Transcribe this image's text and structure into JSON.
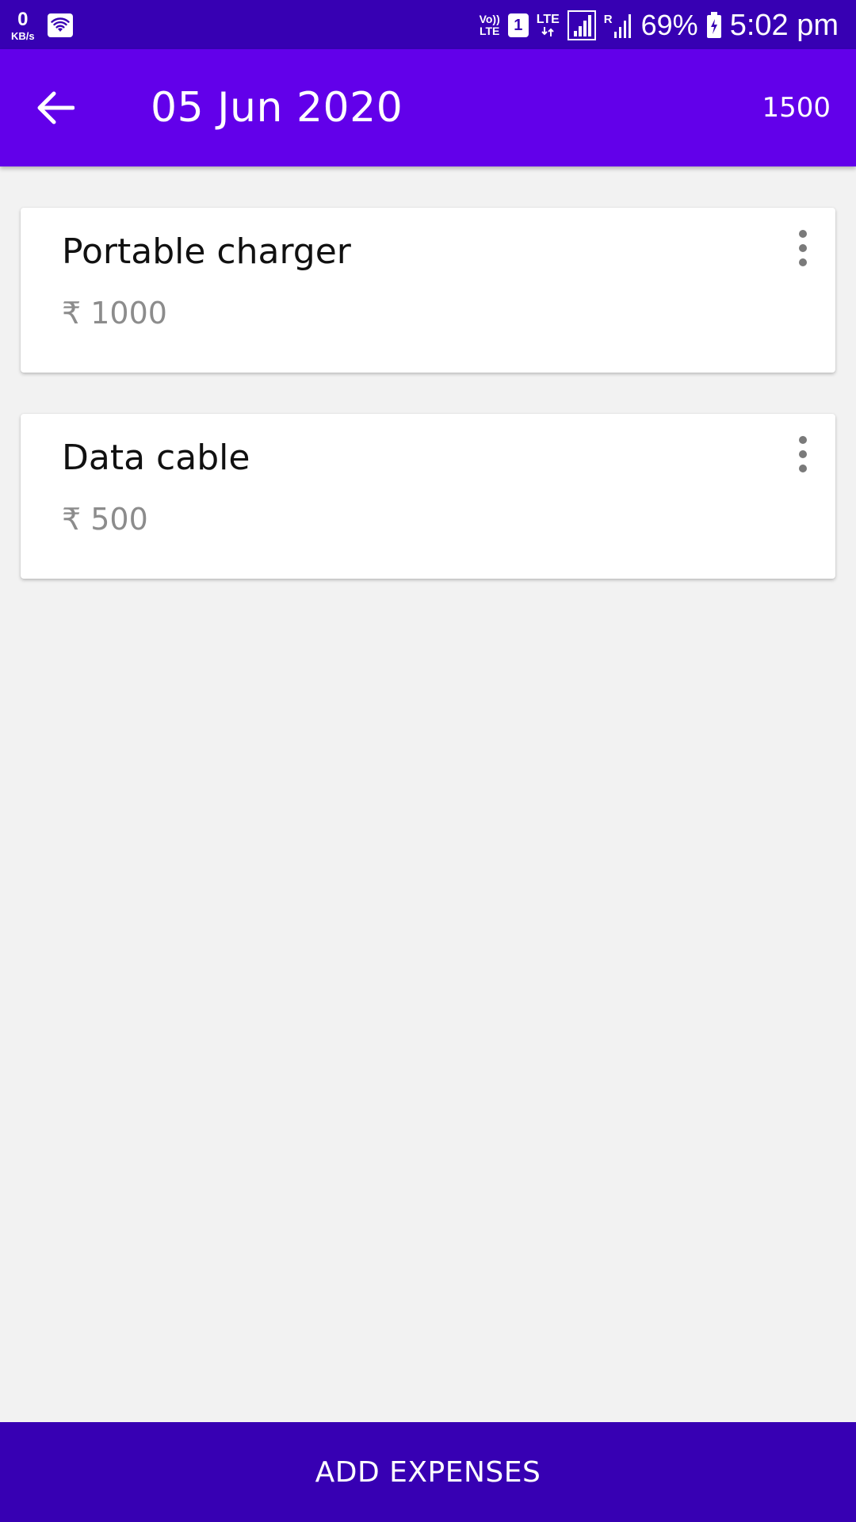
{
  "status_bar": {
    "network_speed_value": "0",
    "network_speed_unit": "KB/s",
    "volte_top": "Vo))",
    "volte_bottom": "LTE",
    "sim_slot": "1",
    "lte_label": "LTE",
    "roaming_label": "R",
    "battery_percent": "69%",
    "time": "5:02 pm"
  },
  "app_bar": {
    "title": "05 Jun 2020",
    "total": "1500"
  },
  "expenses": [
    {
      "name": "Portable charger",
      "amount": "₹ 1000"
    },
    {
      "name": "Data cable",
      "amount": "₹ 500"
    }
  ],
  "bottom_button": {
    "label": "ADD EXPENSES"
  },
  "colors": {
    "status_bar": "#3700B3",
    "app_bar": "#6200EA",
    "background": "#F2F2F2",
    "button": "#3700B3"
  },
  "icons": [
    "wifi-icon",
    "signal-icon",
    "battery-icon",
    "back-arrow-icon",
    "more-vert-icon"
  ]
}
